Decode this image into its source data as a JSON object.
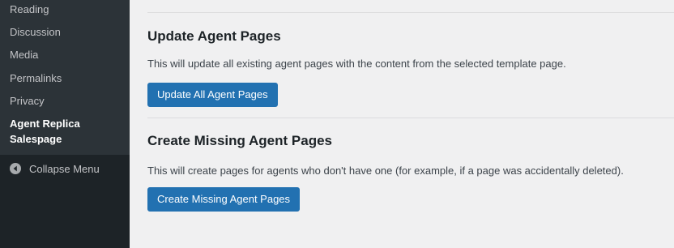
{
  "sidebar": {
    "items": [
      {
        "label": "Reading"
      },
      {
        "label": "Discussion"
      },
      {
        "label": "Media"
      },
      {
        "label": "Permalinks"
      },
      {
        "label": "Privacy"
      },
      {
        "label": "Agent Replica Salespage",
        "current": true
      }
    ],
    "collapse_label": "Collapse Menu"
  },
  "main": {
    "sections": [
      {
        "title": "Update Agent Pages",
        "description": "This will update all existing agent pages with the content from the selected template page.",
        "button_label": "Update All Agent Pages"
      },
      {
        "title": "Create Missing Agent Pages",
        "description": "This will create pages for agents who don't have one (for example, if a page was accidentally deleted).",
        "button_label": "Create Missing Agent Pages"
      }
    ]
  },
  "colors": {
    "sidebar_bg": "#1d2327",
    "submenu_bg": "#2c3338",
    "accent": "#2271b1",
    "page_bg": "#f0f0f1"
  }
}
